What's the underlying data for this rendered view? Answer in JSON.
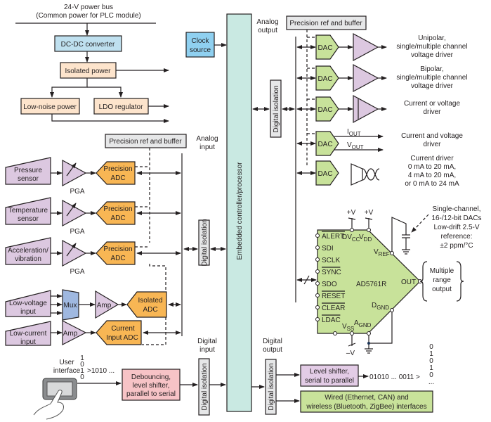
{
  "colors": {
    "blue_box": "#bfe0ef",
    "clock_box": "#8fd0f0",
    "peach_box": "#fde4cc",
    "purple": "#dcc8e0",
    "orange_adc": "#f8b654",
    "mux_blue": "#9fb8e0",
    "controller": "#c9e9e2",
    "grey_box": "#e6e7e8",
    "green_dac": "#c8e29a",
    "pink_box": "#f7c3c6",
    "lavender_box": "#e3cce6",
    "line": "#231f20"
  },
  "power": {
    "bus_line1": "24-V power bus",
    "bus_line2": "(Common power for PLC module)",
    "dcdc": "DC-DC converter",
    "isolated": "Isolated power",
    "lownoise": "Low-noise power",
    "ldo": "LDO regulator"
  },
  "clock": {
    "line1": "Clock",
    "line2": "source"
  },
  "controller": {
    "label": "Embedded controller/processor"
  },
  "analog_in": {
    "ref_label": "Precision ref and buffer",
    "bus_label1": "Analog",
    "bus_label2": "input",
    "isolation": "Digital isolation",
    "sensors": [
      {
        "line1": "Pressure",
        "line2": "sensor",
        "amp": "PGA",
        "adc1": "Precision",
        "adc2": "ADC"
      },
      {
        "line1": "Temperature",
        "line2": "sensor",
        "amp": "PGA",
        "adc1": "Precision",
        "adc2": "ADC"
      },
      {
        "line1": "Acceleration/",
        "line2": "vibration",
        "amp": "PGA",
        "adc1": "Precision",
        "adc2": "ADC"
      }
    ],
    "lowvoltage": {
      "line1": "Low-voltage",
      "line2": "input",
      "mux": "Mux",
      "amp": "Amp",
      "adc1": "Isolated",
      "adc2": "ADC"
    },
    "lowcurrent": {
      "line1": "Low-current",
      "line2": "input",
      "amp": "Amp",
      "adc1": "Current",
      "adc2": "Input ADC"
    }
  },
  "analog_out": {
    "label1": "Analog",
    "label2": "output",
    "ref_label": "Precision ref and buffer",
    "isolation": "Digital isolation",
    "dac_label": "DAC",
    "channels": [
      {
        "lines": [
          "Unipolar,",
          "single/multiple channel",
          "voltage driver"
        ]
      },
      {
        "lines": [
          "Bipolar,",
          "single/multiple channel",
          "voltage driver"
        ]
      },
      {
        "lines": [
          "Current or voltage",
          "driver"
        ]
      },
      {
        "lines": [
          "Current and voltage",
          "driver"
        ],
        "iout": "I",
        "iout_sub": "OUT",
        "vout": "V",
        "vout_sub": "OUT"
      },
      {
        "lines": [
          "Current driver",
          "0 mA to 20 mA,",
          "4 mA to 20 mA,",
          "or 0 mA to 24 mA"
        ]
      }
    ]
  },
  "chip": {
    "name": "AD5761R",
    "supply1": "+V",
    "supply2": "+V",
    "neg_supply": "–V",
    "pins_left": [
      "ALERT",
      "SDI",
      "SCLK",
      "SYNC",
      "SDO",
      "RESET",
      "CLEAR",
      "LDAC"
    ],
    "pins_overbar": [
      true,
      false,
      false,
      true,
      false,
      true,
      true,
      true
    ],
    "dvcc": "DV",
    "dvcc_sub": "CC",
    "vdd": "V",
    "vdd_sub": "DD",
    "vref": "V",
    "vref_sub": "REF",
    "out": "OUT",
    "dgnd": "D",
    "dgnd_sub": "GND",
    "agnd": "A",
    "agnd_sub": "GND",
    "vss": "V",
    "vss_sub": "SS",
    "note": [
      "Single-channel,",
      "16-/12-bit DACs",
      "Low-drift 2.5-V",
      "reference:",
      "±2 ppm/°C"
    ],
    "output_note": [
      "Multiple",
      "range",
      "output"
    ]
  },
  "digital_in": {
    "label1": "Digital",
    "label2": "input",
    "isolation": "Digital isolation",
    "ui_label1": "User",
    "ui_label2": "interface",
    "bits_vertical": [
      "1",
      "0",
      "1",
      "0"
    ],
    "bits_serial": ">1010 ...",
    "debounce": [
      "Debouncing,",
      "level shifter,",
      "parallel to serial"
    ]
  },
  "digital_out": {
    "label1": "Digital",
    "label2": "output",
    "isolation": "Digital isolation",
    "level_shifter": [
      "Level shifter,",
      "serial to parallel"
    ],
    "bits_serial": "01010 ... 0011 >",
    "bits_vertical": [
      "0",
      "1",
      "0",
      "1",
      "0",
      "..."
    ],
    "interfaces": [
      "Wired (Ethernet, CAN) and",
      "wireless (Bluetooth, ZigBee) interfaces"
    ]
  }
}
